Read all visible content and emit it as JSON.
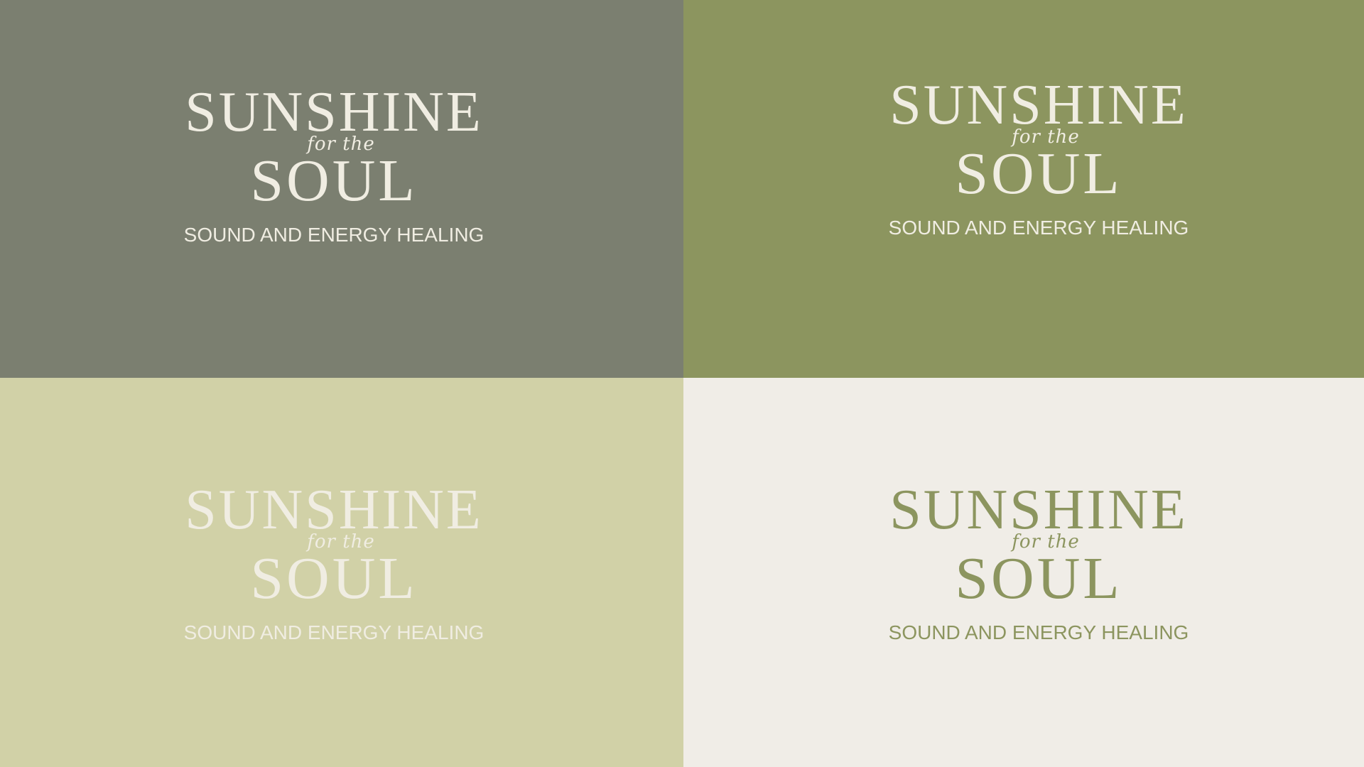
{
  "brand": {
    "name_top": "SUNSHINE",
    "connector": "for the",
    "name_bottom": "SOUL",
    "tagline": "SOUND AND ENERGY HEALING"
  },
  "panels": [
    {
      "position": "top-left",
      "background": "#7b7f70",
      "logo_color": "#f0ede2"
    },
    {
      "position": "top-right",
      "background": "#8c955f",
      "logo_color": "#f0ede2"
    },
    {
      "position": "bottom-left",
      "background": "#d1d1a7",
      "logo_color": "#f0ede2"
    },
    {
      "position": "bottom-right",
      "background": "#f0ede7",
      "logo_color": "#8c955f"
    }
  ]
}
